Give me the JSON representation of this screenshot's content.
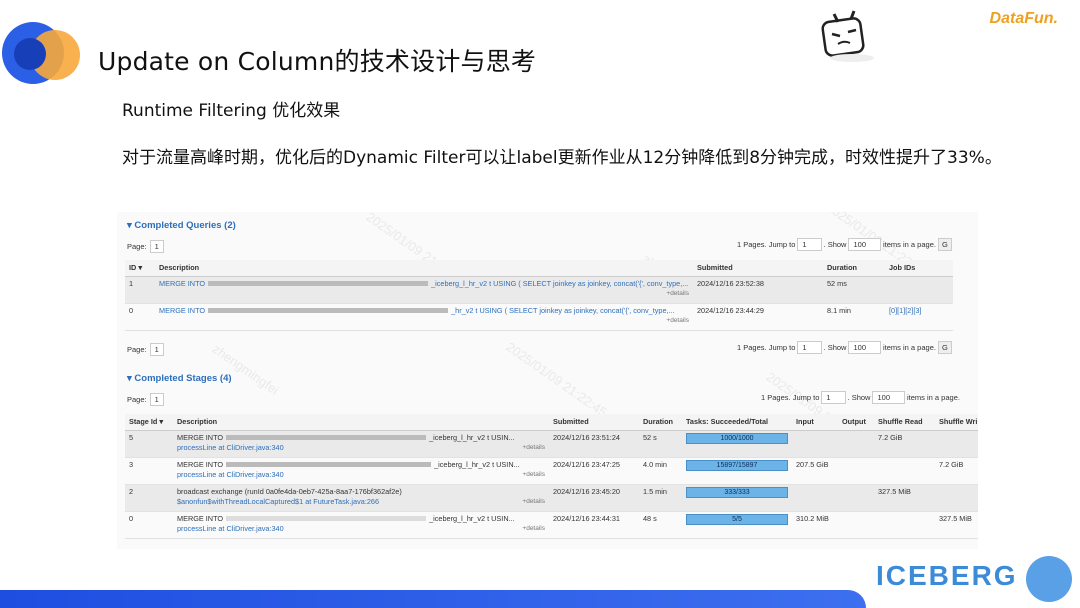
{
  "title": "Update on Column的技术设计与思考",
  "subtitle": "Runtime Filtering 优化效果",
  "paragraph": "对于流量高峰时期，优化后的Dynamic Filter可以让label更新作业从12分钟降低到8分钟完成，时效性提升了33%。",
  "brand": "DataFun.",
  "iceberg": "ICEBERG",
  "queries": {
    "header": "▾ Completed Queries (2)",
    "page_label": "Page:",
    "page_value": "1",
    "pages_text": "1 Pages. Jump to",
    "jump_value": "1",
    "show_text": ". Show",
    "show_value": "100",
    "items_text": "items in a page.",
    "go": "G",
    "columns": [
      "ID ▾",
      "Description",
      "Submitted",
      "Duration",
      "Job IDs"
    ],
    "rows": [
      {
        "id": "1",
        "desc_prefix": "MERGE INTO",
        "desc_suffix": "_iceberg_l_hr_v2 t USING ( SELECT joinkey as joinkey, concat('{', conv_type,...",
        "details": "+details",
        "submitted": "2024/12/16 23:52:38",
        "duration": "52 ms",
        "jobs": ""
      },
      {
        "id": "0",
        "desc_prefix": "MERGE INTO",
        "desc_suffix": "_hr_v2 t USING ( SELECT joinkey as joinkey, concat('{', conv_type,...",
        "details": "+details",
        "submitted": "2024/12/16 23:44:29",
        "duration": "8.1 min",
        "jobs": "[0][1][2][3]"
      }
    ],
    "footer_page_label": "Page:",
    "footer_page_value": "1"
  },
  "stages": {
    "header": "▾ Completed Stages (4)",
    "page_label": "Page:",
    "page_value": "1",
    "pages_text": "1 Pages. Jump to",
    "jump_value": "1",
    "show_text": ". Show",
    "show_value": "100",
    "items_text": "items in a page.",
    "columns": [
      "Stage Id ▾",
      "Description",
      "Submitted",
      "Duration",
      "Tasks: Succeeded/Total",
      "Input",
      "Output",
      "Shuffle Read",
      "Shuffle Wri"
    ],
    "rows": [
      {
        "id": "5",
        "desc": "MERGE INTO",
        "desc_suffix": "_iceberg_l_hr_v2 t USIN...",
        "sub": "processLine at CliDriver.java:340",
        "details": "+details",
        "submitted": "2024/12/16 23:51:24",
        "duration": "52 s",
        "tasks": "1000/1000",
        "input": "",
        "output": "",
        "sread": "7.2 GiB",
        "swrite": ""
      },
      {
        "id": "3",
        "desc": "MERGE INTO",
        "desc_suffix": "_iceberg_l_hr_v2 t USIN...",
        "sub": "processLine at CliDriver.java:340",
        "details": "+details",
        "submitted": "2024/12/16 23:47:25",
        "duration": "4.0 min",
        "tasks": "15897/15897",
        "input": "207.5 GiB",
        "output": "",
        "sread": "",
        "swrite": "7.2 GiB"
      },
      {
        "id": "2",
        "desc": "broadcast exchange (runId 0a0fe4da-0eb7-425a-8aa7-176bf362af2e)",
        "desc_suffix": "",
        "sub": "$anonfun$withThreadLocalCaptured$1 at FutureTask.java:266",
        "details": "+details",
        "submitted": "2024/12/16 23:45:20",
        "duration": "1.5 min",
        "tasks": "333/333",
        "input": "",
        "output": "",
        "sread": "327.5 MiB",
        "swrite": ""
      },
      {
        "id": "0",
        "desc": "MERGE INTO",
        "desc_suffix": "_iceberg_l_hr_v2 t USIN...",
        "sub": "processLine at CliDriver.java:340",
        "details": "+details",
        "submitted": "2024/12/16 23:44:31",
        "duration": "48 s",
        "tasks": "5/5",
        "input": "310.2 MiB",
        "output": "",
        "sread": "",
        "swrite": "327.5 MiB"
      }
    ]
  },
  "colors": {
    "accent": "#2d6fba",
    "bar": "#6cb3e8",
    "brand": "#f0a020",
    "bottom": "#1e4ee0"
  },
  "icons": [
    "logo-circles-icon",
    "mascot-icon",
    "iceberg-logo-icon"
  ]
}
